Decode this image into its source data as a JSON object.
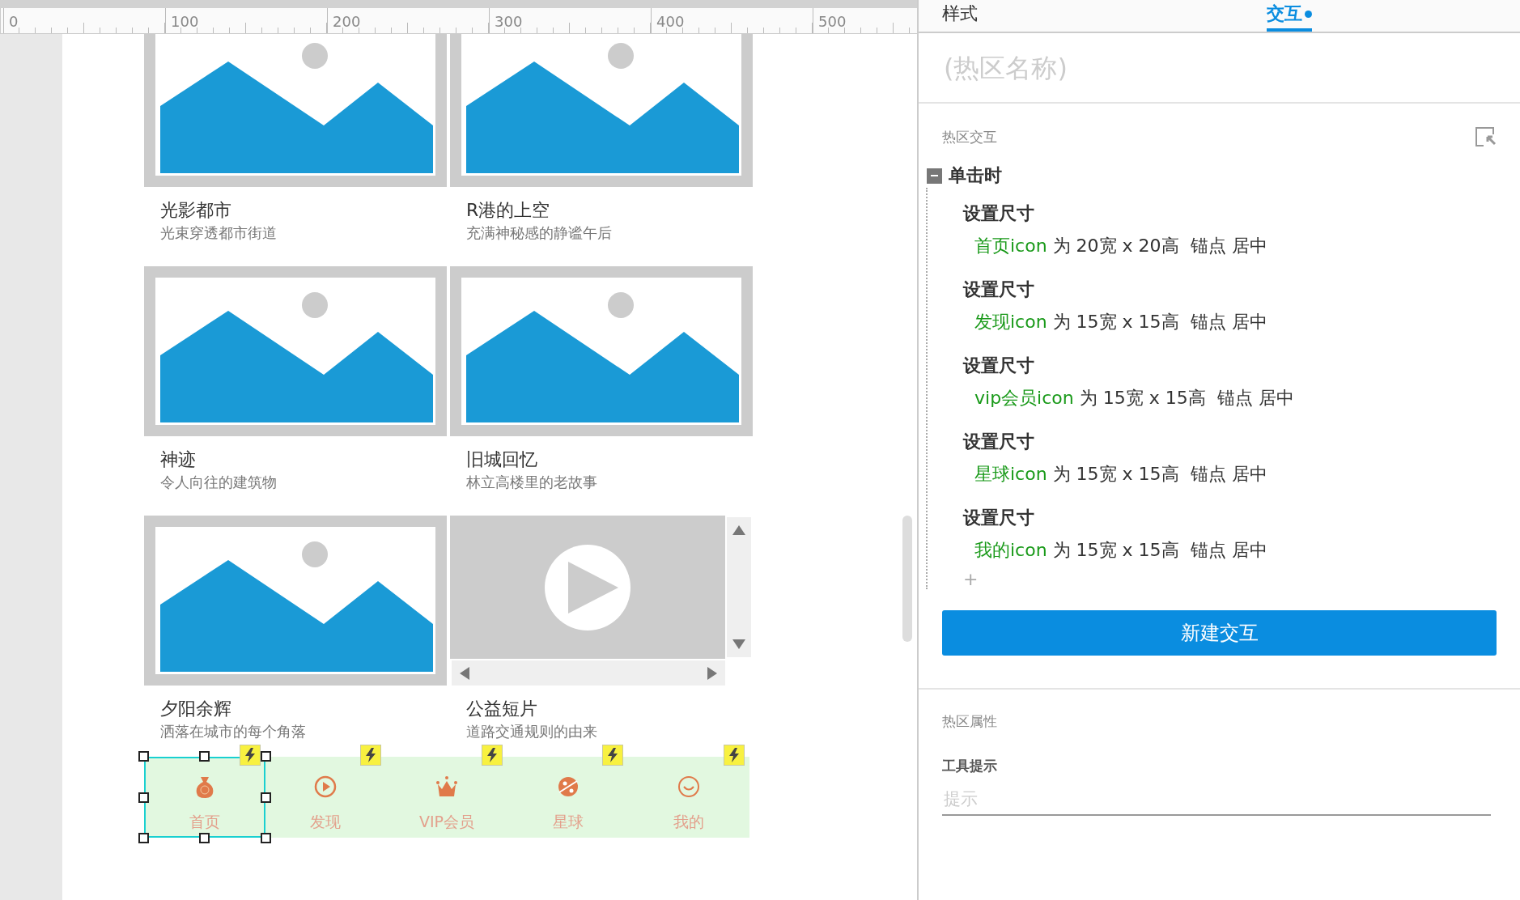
{
  "ruler": {
    "labels": [
      "0",
      "100",
      "200",
      "300",
      "400",
      "500"
    ]
  },
  "cards": [
    {
      "kind": "image",
      "title": "光影都市",
      "subtitle": "光束穿透都市街道"
    },
    {
      "kind": "image",
      "title": "R港的上空",
      "subtitle": "充满神秘感的静谧午后"
    },
    {
      "kind": "image",
      "title": "神迹",
      "subtitle": "令人向往的建筑物"
    },
    {
      "kind": "image",
      "title": "旧城回忆",
      "subtitle": "林立高楼里的老故事"
    },
    {
      "kind": "image",
      "title": "夕阳余辉",
      "subtitle": "洒落在城市的每个角落"
    },
    {
      "kind": "video",
      "title": "公益短片",
      "subtitle": "道路交通规则的由来"
    }
  ],
  "nav_bar": {
    "items": [
      {
        "label": "首页",
        "selected": true
      },
      {
        "label": "发现",
        "selected": false
      },
      {
        "label": "VIP会员",
        "selected": false
      },
      {
        "label": "星球",
        "selected": false
      },
      {
        "label": "我的",
        "selected": false
      }
    ]
  },
  "panel": {
    "tabs": [
      {
        "label": "样式",
        "selected": false,
        "dot": false
      },
      {
        "label": "交互",
        "selected": true,
        "dot": true
      }
    ],
    "name_field": {
      "placeholder": "(热区名称)"
    },
    "interactions": {
      "title": "热区交互",
      "events": [
        {
          "name": "单击时",
          "expanded": true,
          "actions": [
            {
              "name": "设置尺寸",
              "target": "首页icon",
              "detail": "为 20宽 x 20高  锚点 居中"
            },
            {
              "name": "设置尺寸",
              "target": "发现icon",
              "detail": "为 15宽 x 15高  锚点 居中"
            },
            {
              "name": "设置尺寸",
              "target": "vip会员icon",
              "detail": "为 15宽 x 15高  锚点 居中"
            },
            {
              "name": "设置尺寸",
              "target": "星球icon",
              "detail": "为 15宽 x 15高  锚点 居中"
            },
            {
              "name": "设置尺寸",
              "target": "我的icon",
              "detail": "为 15宽 x 15高  锚点 居中"
            }
          ],
          "add": "+"
        }
      ],
      "button": "新建交互"
    },
    "properties": {
      "title": "热区属性",
      "tooltip": {
        "label": "工具提示",
        "placeholder": "提示"
      }
    }
  }
}
